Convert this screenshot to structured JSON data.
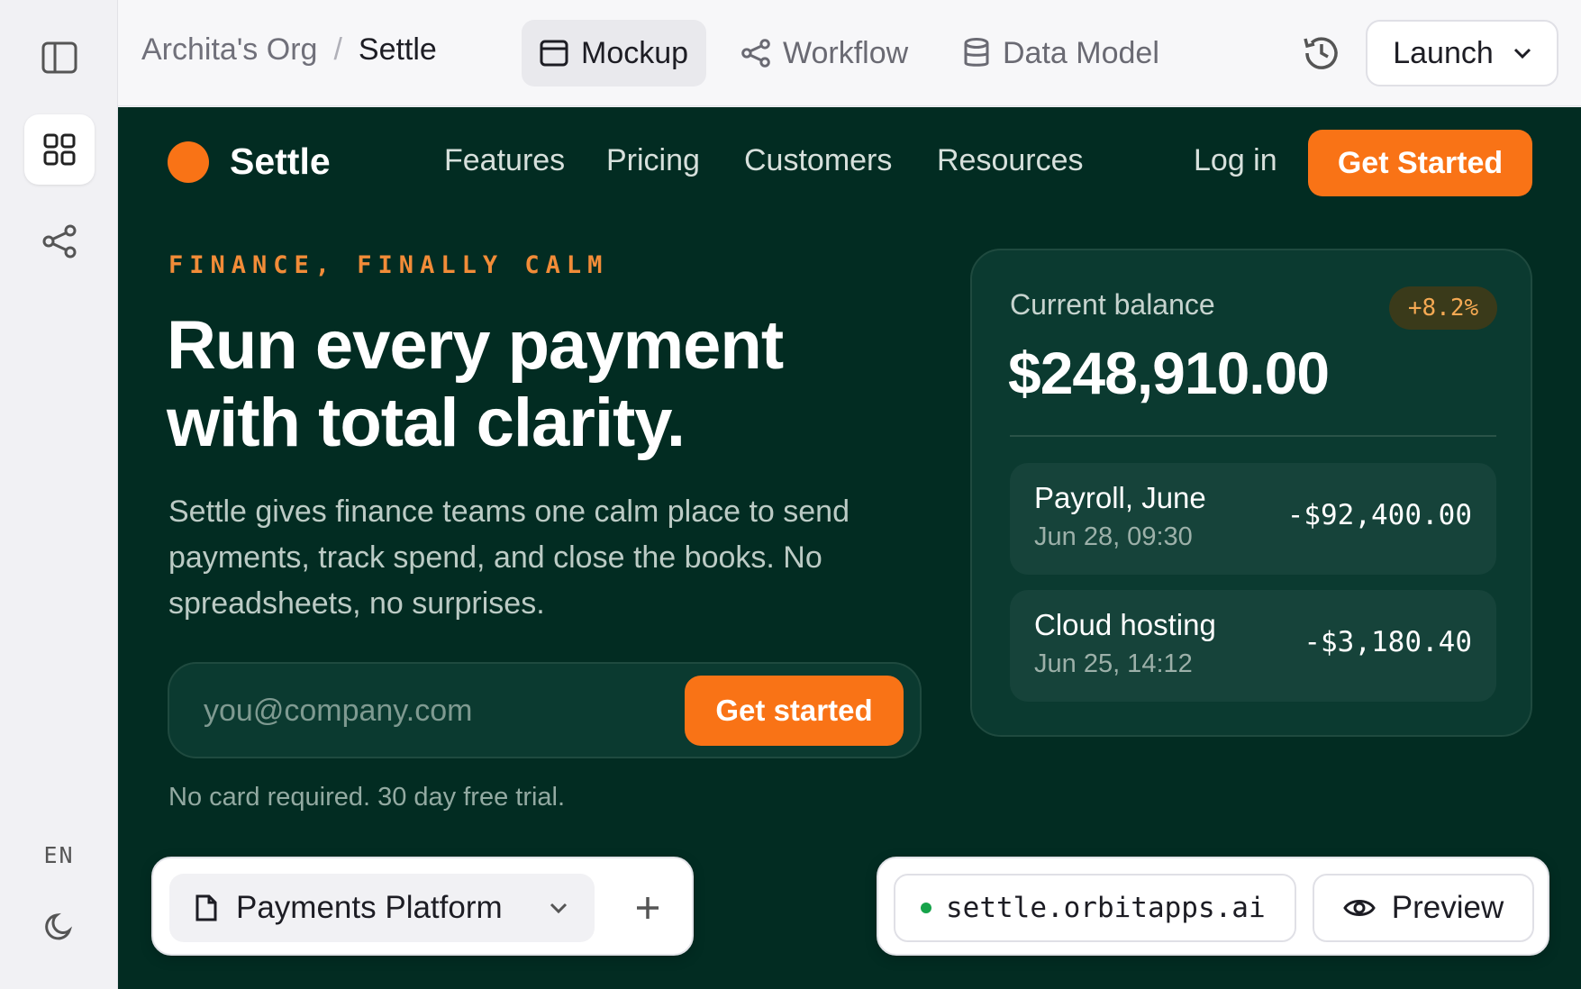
{
  "breadcrumb": {
    "org": "Archita's Org",
    "separator": "/",
    "project": "Settle"
  },
  "tabs": [
    {
      "label": "Mockup",
      "icon": "window-icon",
      "active": true
    },
    {
      "label": "Workflow",
      "icon": "share-nodes-icon",
      "active": false
    },
    {
      "label": "Data Model",
      "icon": "database-icon",
      "active": false
    }
  ],
  "launch": {
    "label": "Launch"
  },
  "rail": {
    "language": "EN"
  },
  "site": {
    "brand": "Settle",
    "nav": [
      "Features",
      "Pricing",
      "Customers",
      "Resources"
    ],
    "login": "Log in",
    "cta": "Get Started",
    "eyebrow": "FINANCE, FINALLY CALM",
    "headline_line1": "Run every payment",
    "headline_line2": "with total clarity.",
    "subtext": "Settle gives finance teams one calm place to send payments, track spend, and close the books. No spreadsheets, no surprises.",
    "email_placeholder": "you@company.com",
    "signup_button": "Get started",
    "note": "No card required. 30 day free trial."
  },
  "balance": {
    "label": "Current balance",
    "change": "+8.2%",
    "amount": "$248,910.00",
    "transactions": [
      {
        "name": "Payroll, June",
        "time": "Jun 28, 09:30",
        "amount": "-$92,400.00"
      },
      {
        "name": "Cloud hosting",
        "time": "Jun 25, 14:12",
        "amount": "-$3,180.40"
      }
    ]
  },
  "bottom": {
    "project": "Payments Platform",
    "url": "settle.orbitapps.ai",
    "preview": "Preview"
  },
  "colors": {
    "accent": "#f97316",
    "stage_bg": "#022c22",
    "status_dot": "#16a34a"
  }
}
